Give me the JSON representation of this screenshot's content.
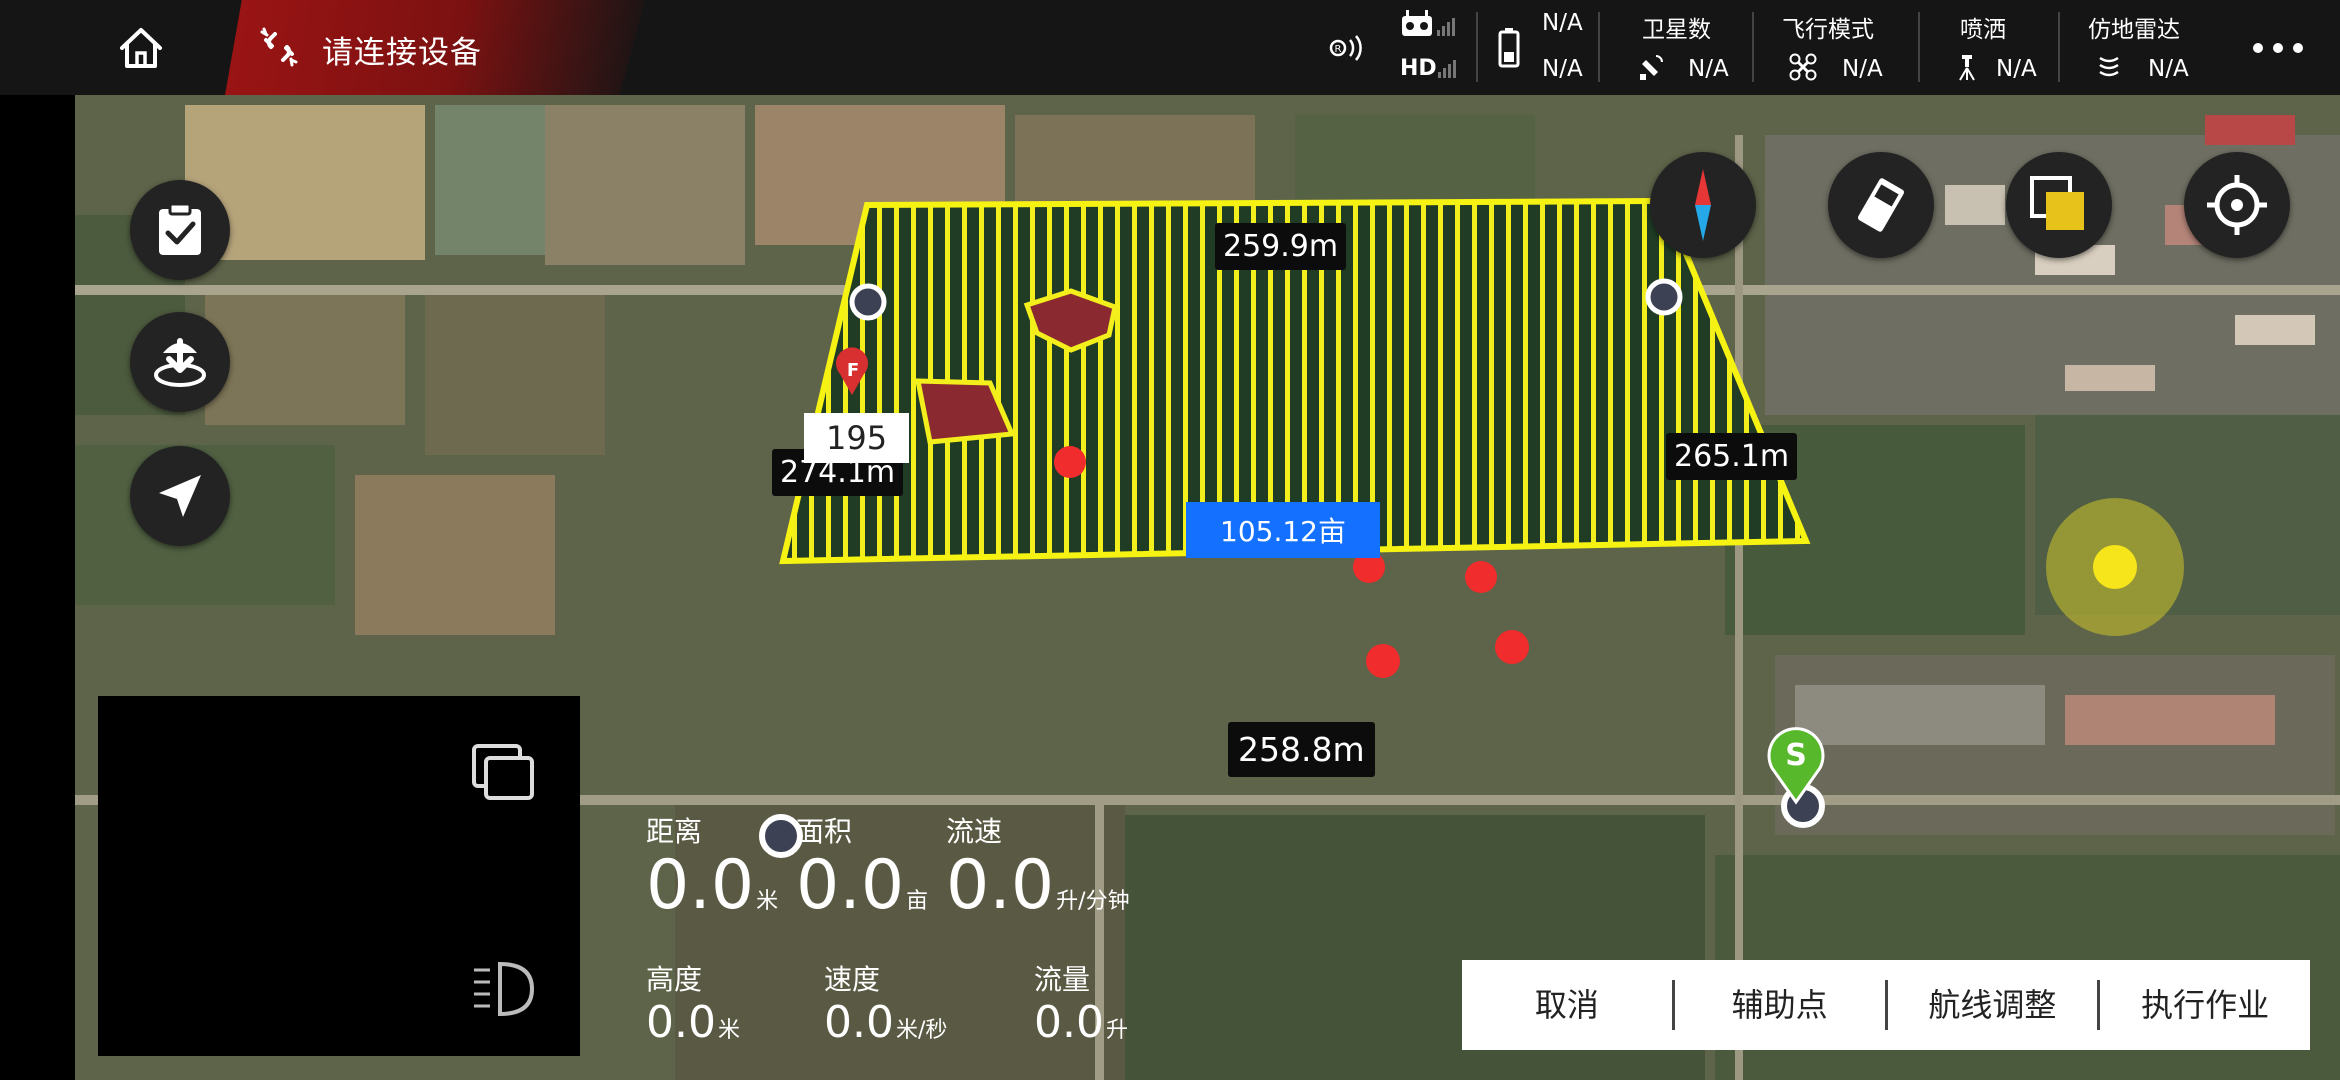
{
  "topbar": {
    "connection_status": "请连接设备",
    "controller": {
      "hd_label": "HD"
    },
    "battery": {
      "value1": "N/A",
      "value2": "N/A"
    },
    "satellites": {
      "label": "卫星数",
      "value": "N/A"
    },
    "flight_mode": {
      "label": "飞行模式",
      "value": "N/A"
    },
    "spray": {
      "label": "喷洒",
      "value": "N/A"
    },
    "terrain_radar": {
      "label": "仿地雷达",
      "value": "N/A"
    }
  },
  "map": {
    "measurements": {
      "top_edge": "259.9m",
      "left_edge": "274.1m",
      "right_edge": "265.1m",
      "bottom_edge": "258.8m"
    },
    "area": "105.12亩",
    "waypoint_value": "195",
    "marker_f": "F",
    "marker_s": "S"
  },
  "telemetry": {
    "distance": {
      "label": "距离",
      "value": "0.0",
      "unit": "米"
    },
    "area": {
      "label": "面积",
      "value": "0.0",
      "unit": "亩"
    },
    "flow_rate": {
      "label": "流速",
      "value": "0.0",
      "unit": "升/分钟"
    },
    "height": {
      "label": "高度",
      "value": "0.0",
      "unit": "米"
    },
    "speed": {
      "label": "速度",
      "value": "0.0",
      "unit": "米/秒"
    },
    "flow": {
      "label": "流量",
      "value": "0.0",
      "unit": "升"
    }
  },
  "actions": {
    "cancel": "取消",
    "aux_point": "辅助点",
    "route_adjust": "航线调整",
    "execute": "执行作业"
  },
  "colors": {
    "field_stripe": "#f2ef1c",
    "field_dark": "#1f3a22",
    "obstacle": "#8a2a30",
    "point_red": "#f02c2c",
    "area_tag": "#1470ff",
    "status_bg": "#9c1414"
  }
}
